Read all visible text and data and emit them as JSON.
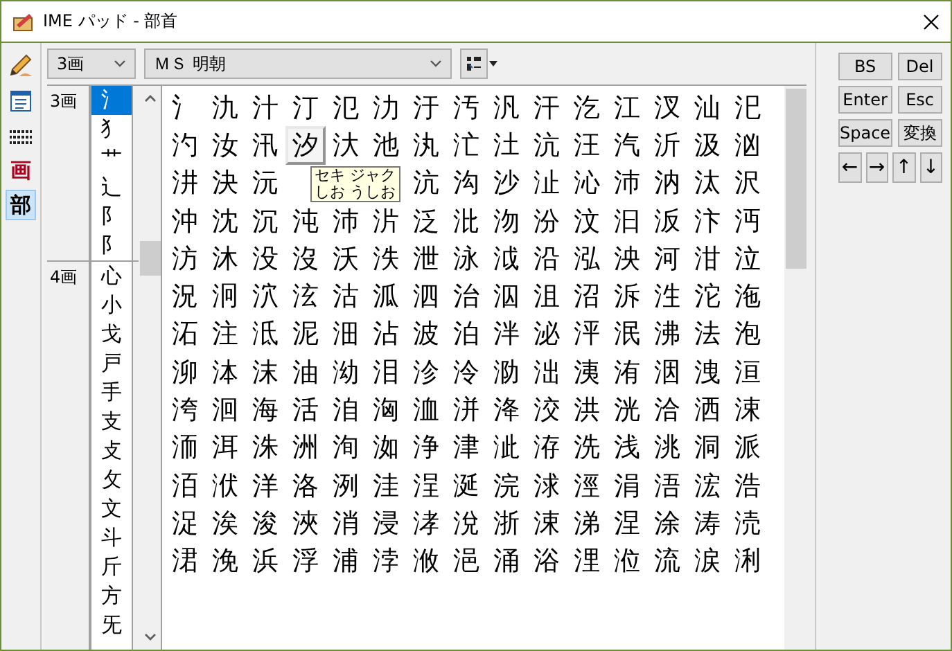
{
  "window": {
    "title": "IME パッド - 部首"
  },
  "tools": [
    {
      "kind": "pencil",
      "selected": false
    },
    {
      "kind": "list",
      "selected": false
    },
    {
      "kind": "keyboard",
      "selected": false
    },
    {
      "kind": "glyph",
      "label": "画",
      "selected": false
    },
    {
      "kind": "glyph",
      "label": "部",
      "selected": true
    }
  ],
  "stroke_select": {
    "value": "3画"
  },
  "font_select": {
    "value": "ＭＳ 明朝"
  },
  "radical_groups": [
    {
      "label": "3画",
      "radicals": [
        {
          "char": "氵",
          "selected": true
        },
        {
          "char": "犭",
          "selected": false
        },
        {
          "char": "艹",
          "selected": false
        },
        {
          "char": "辶",
          "selected": false
        },
        {
          "char": "阝",
          "selected": false
        },
        {
          "char": "阝",
          "selected": false
        }
      ]
    },
    {
      "label": "4画",
      "radicals": [
        {
          "char": "心",
          "selected": false
        },
        {
          "char": "小",
          "selected": false
        },
        {
          "char": "戈",
          "selected": false
        },
        {
          "char": "戸",
          "selected": false
        },
        {
          "char": "手",
          "selected": false
        },
        {
          "char": "支",
          "selected": false
        },
        {
          "char": "攴",
          "selected": false
        },
        {
          "char": "攵",
          "selected": false
        },
        {
          "char": "文",
          "selected": false
        },
        {
          "char": "斗",
          "selected": false
        },
        {
          "char": "斤",
          "selected": false
        },
        {
          "char": "方",
          "selected": false
        },
        {
          "char": "旡",
          "selected": false
        }
      ]
    }
  ],
  "grid": {
    "rows": [
      [
        {
          "char": "氵"
        },
        {
          "char": "氿"
        },
        {
          "char": "汁"
        },
        {
          "char": "汀"
        },
        {
          "char": "氾"
        },
        {
          "char": "氻"
        },
        {
          "char": "汙"
        },
        {
          "char": "汚"
        },
        {
          "char": "汎"
        },
        {
          "char": "汗"
        },
        {
          "char": "汔"
        },
        {
          "char": "江"
        },
        {
          "char": "汊"
        },
        {
          "char": "汕"
        },
        {
          "char": "汜"
        }
      ],
      [
        {
          "char": "汋"
        },
        {
          "char": "汝"
        },
        {
          "char": "汛"
        },
        {
          "char": "汐",
          "selected": true
        },
        {
          "char": "汏"
        },
        {
          "char": "池"
        },
        {
          "char": "汍"
        },
        {
          "char": "汒"
        },
        {
          "char": "汢"
        },
        {
          "char": "沆"
        },
        {
          "char": "汪"
        },
        {
          "char": "汽"
        },
        {
          "char": "沂"
        },
        {
          "char": "汲"
        },
        {
          "char": "汹"
        }
      ],
      [
        {
          "char": "汫"
        },
        {
          "char": "決"
        },
        {
          "char": "沅"
        },
        {
          "kind": "tooltip",
          "lines": [
            "セキ ジャク",
            "しお うしお"
          ]
        },
        {},
        {},
        {
          "char": "沆"
        },
        {
          "char": "沟"
        },
        {
          "char": "沙"
        },
        {
          "char": "沚"
        },
        {
          "char": "沁"
        },
        {
          "char": "沛"
        },
        {
          "char": "汭"
        },
        {
          "char": "汰"
        },
        {
          "char": "沢"
        }
      ],
      [
        {
          "char": "沖"
        },
        {
          "char": "沈"
        },
        {
          "char": "沉"
        },
        {
          "char": "沌"
        },
        {
          "char": "沛"
        },
        {
          "char": "沜"
        },
        {
          "char": "泛"
        },
        {
          "char": "沘"
        },
        {
          "char": "沕"
        },
        {
          "char": "汾"
        },
        {
          "char": "汶"
        },
        {
          "char": "汩"
        },
        {
          "char": "汳"
        },
        {
          "char": "汴"
        },
        {
          "char": "沔"
        }
      ],
      [
        {
          "char": "汸"
        },
        {
          "char": "沐"
        },
        {
          "char": "没"
        },
        {
          "char": "沒"
        },
        {
          "char": "沃"
        },
        {
          "char": "泆"
        },
        {
          "char": "泄"
        },
        {
          "char": "泳"
        },
        {
          "char": "泧"
        },
        {
          "char": "沿"
        },
        {
          "char": "泓"
        },
        {
          "char": "泱"
        },
        {
          "char": "河"
        },
        {
          "char": "泔"
        },
        {
          "char": "泣"
        }
      ],
      [
        {
          "char": "況"
        },
        {
          "char": "泂"
        },
        {
          "char": "泬"
        },
        {
          "char": "泫"
        },
        {
          "char": "沽"
        },
        {
          "char": "泒"
        },
        {
          "char": "泗"
        },
        {
          "char": "治"
        },
        {
          "char": "泅"
        },
        {
          "char": "沮"
        },
        {
          "char": "沼"
        },
        {
          "char": "泝"
        },
        {
          "char": "泩"
        },
        {
          "char": "沱"
        },
        {
          "char": "沲"
        }
      ],
      [
        {
          "char": "沰"
        },
        {
          "char": "注"
        },
        {
          "char": "泜"
        },
        {
          "char": "泥"
        },
        {
          "char": "沺"
        },
        {
          "char": "沾"
        },
        {
          "char": "波"
        },
        {
          "char": "泊"
        },
        {
          "char": "泮"
        },
        {
          "char": "泌"
        },
        {
          "char": "泙"
        },
        {
          "char": "泯"
        },
        {
          "char": "沸"
        },
        {
          "char": "法"
        },
        {
          "char": "泡"
        }
      ],
      [
        {
          "char": "泖"
        },
        {
          "char": "泍"
        },
        {
          "char": "沫"
        },
        {
          "char": "油"
        },
        {
          "char": "泑"
        },
        {
          "char": "泪"
        },
        {
          "char": "沴"
        },
        {
          "char": "泠"
        },
        {
          "char": "泐"
        },
        {
          "char": "泏"
        },
        {
          "char": "洟"
        },
        {
          "char": "洧"
        },
        {
          "char": "洇"
        },
        {
          "char": "洩"
        },
        {
          "char": "洹"
        }
      ],
      [
        {
          "char": "洿"
        },
        {
          "char": "洄"
        },
        {
          "char": "海"
        },
        {
          "char": "活"
        },
        {
          "char": "洎"
        },
        {
          "char": "洶"
        },
        {
          "char": "洫"
        },
        {
          "char": "洴"
        },
        {
          "char": "洚"
        },
        {
          "char": "洨"
        },
        {
          "char": "洪"
        },
        {
          "char": "洸"
        },
        {
          "char": "洽"
        },
        {
          "char": "洒"
        },
        {
          "char": "涑"
        }
      ],
      [
        {
          "char": "洏"
        },
        {
          "char": "洱"
        },
        {
          "char": "洙"
        },
        {
          "char": "洲"
        },
        {
          "char": "洵"
        },
        {
          "char": "洳"
        },
        {
          "char": "浄"
        },
        {
          "char": "津"
        },
        {
          "char": "泚"
        },
        {
          "char": "洊"
        },
        {
          "char": "洗"
        },
        {
          "char": "浅"
        },
        {
          "char": "洮"
        },
        {
          "char": "洞"
        },
        {
          "char": "派"
        }
      ],
      [
        {
          "char": "洦"
        },
        {
          "char": "洑"
        },
        {
          "char": "洋"
        },
        {
          "char": "洛"
        },
        {
          "char": "洌"
        },
        {
          "char": "洼"
        },
        {
          "char": "浧"
        },
        {
          "char": "涎"
        },
        {
          "char": "浣"
        },
        {
          "char": "浗"
        },
        {
          "char": "涇"
        },
        {
          "char": "涓"
        },
        {
          "char": "浯"
        },
        {
          "char": "浤"
        },
        {
          "char": "浩"
        }
      ],
      [
        {
          "char": "浞"
        },
        {
          "char": "涘"
        },
        {
          "char": "浚"
        },
        {
          "char": "浹"
        },
        {
          "char": "消"
        },
        {
          "char": "浸"
        },
        {
          "char": "涍"
        },
        {
          "char": "涗"
        },
        {
          "char": "浙"
        },
        {
          "char": "涑"
        },
        {
          "char": "涕"
        },
        {
          "char": "涅"
        },
        {
          "char": "涂"
        },
        {
          "char": "涛"
        },
        {
          "char": "涜"
        }
      ],
      [
        {
          "char": "涒"
        },
        {
          "char": "浼"
        },
        {
          "char": "浜"
        },
        {
          "char": "浮"
        },
        {
          "char": "浦"
        },
        {
          "char": "浡"
        },
        {
          "char": "浟"
        },
        {
          "char": "浥"
        },
        {
          "char": "涌"
        },
        {
          "char": "浴"
        },
        {
          "char": "浬"
        },
        {
          "char": "涖"
        },
        {
          "char": "流"
        },
        {
          "char": "涙"
        },
        {
          "char": "浰"
        }
      ]
    ]
  },
  "keys": [
    {
      "label": "BS"
    },
    {
      "label": "Del"
    },
    {
      "label": "Enter"
    },
    {
      "label": "Esc"
    },
    {
      "label": "Space"
    },
    {
      "label": "変換"
    }
  ],
  "arrow_keys": [
    {
      "label": "←"
    },
    {
      "label": "→"
    },
    {
      "label": "↑"
    },
    {
      "label": "↓"
    }
  ]
}
